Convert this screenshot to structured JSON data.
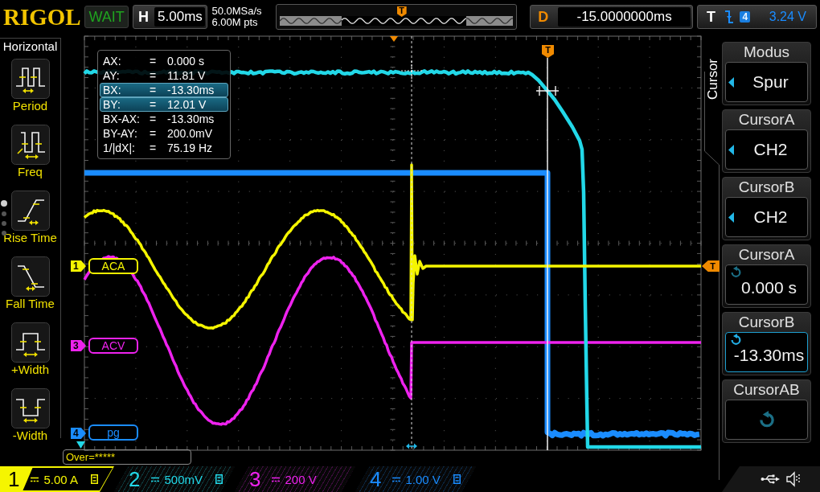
{
  "header": {
    "brand": "RIGOL",
    "run_status": "WAIT",
    "timebase": {
      "label": "H",
      "value": "5.00ms"
    },
    "sample_rate": "50.0MSa/s",
    "memory_depth": "6.00M pts",
    "overview": {
      "trigger_marker": "T"
    },
    "delay": {
      "label": "D",
      "value": "-15.0000000ms"
    },
    "trigger": {
      "label": "T",
      "kind": "falling",
      "source": "4",
      "level": "3.24 V"
    }
  },
  "sidebar": {
    "title": "Horizontal",
    "items": [
      {
        "label": "Period",
        "kind": "period"
      },
      {
        "label": "Freq",
        "kind": "freq"
      },
      {
        "label": "Rise Time",
        "kind": "rise_time"
      },
      {
        "label": "Fall Time",
        "kind": "fall_time"
      },
      {
        "label": "+Width",
        "kind": "pos_width"
      },
      {
        "label": "-Width",
        "kind": "neg_width"
      }
    ],
    "pages": [
      {
        "selected": true
      },
      {
        "selected": false
      },
      {
        "selected": false
      },
      {
        "selected": false
      }
    ]
  },
  "channels": [
    {
      "number": "1",
      "marker": "1",
      "label": "ACA",
      "scale": "5.00 A",
      "color": "#f5f500",
      "selected": true,
      "bandwidth_limit": true
    },
    {
      "number": "2",
      "scale": "500mV",
      "color": "#22d8e8",
      "selected": false,
      "bandwidth_limit": true
    },
    {
      "number": "3",
      "marker": "3",
      "label": "ACV",
      "scale": "200 V",
      "color": "#ee22ee",
      "selected": false,
      "bandwidth_limit": false
    },
    {
      "number": "4",
      "marker": "4",
      "label": "pg",
      "scale": "1.00 V",
      "color": "#1a8cff",
      "selected": false,
      "bandwidth_limit": true
    }
  ],
  "scope": {
    "trigger_position_marker": "T",
    "trigger_level_marker": "T",
    "cursor_readout": [
      {
        "label": "AX:",
        "op": "=",
        "value": "0.000 s",
        "selected": false
      },
      {
        "label": "AY:",
        "op": "=",
        "value": "11.81 V",
        "selected": false
      },
      {
        "label": "BX:",
        "op": "=",
        "value": "-13.30ms",
        "selected": true
      },
      {
        "label": "BY:",
        "op": "=",
        "value": "12.01 V",
        "selected": true
      },
      {
        "label": "BX-AX:",
        "op": "=",
        "value": "-13.30ms",
        "selected": false
      },
      {
        "label": "BY-AY:",
        "op": "=",
        "value": "200.0mV",
        "selected": false
      },
      {
        "label": "1/|dX|:",
        "op": "=",
        "value": "75.19 Hz",
        "selected": false
      }
    ],
    "status": "Over=*****"
  },
  "menu": {
    "tab": "Cursor",
    "softkeys": [
      {
        "title": "Modus",
        "value": "Spur",
        "kind": "select",
        "selected": false
      },
      {
        "title": "CursorA",
        "value": "CH2",
        "kind": "select",
        "selected": false
      },
      {
        "title": "CursorB",
        "value": "CH2",
        "kind": "select",
        "selected": false
      },
      {
        "title": "CursorA",
        "value": "0.000 s",
        "kind": "knob",
        "selected": false
      },
      {
        "title": "CursorB",
        "value": "-13.30ms",
        "kind": "knob",
        "selected": true
      },
      {
        "title": "CursorAB",
        "kind": "knob",
        "selected": false
      }
    ]
  }
}
